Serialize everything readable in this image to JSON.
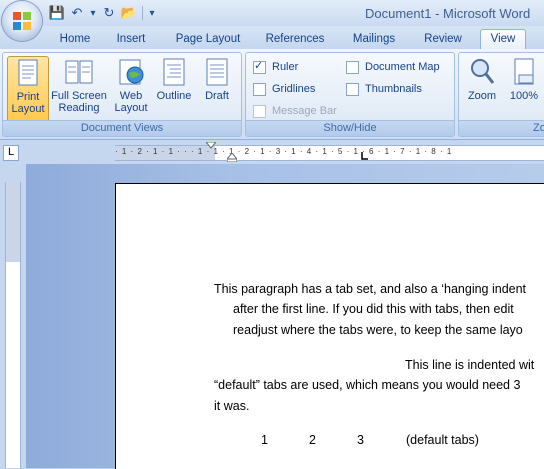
{
  "window": {
    "title": "Document1 - Microsoft Word"
  },
  "quick_access": [
    {
      "name": "save",
      "glyph": "💾"
    },
    {
      "name": "undo",
      "glyph": "↶"
    },
    {
      "name": "undo-dropdown",
      "glyph": "▾"
    },
    {
      "name": "redo",
      "glyph": "↻"
    },
    {
      "name": "open",
      "glyph": "📂"
    },
    {
      "name": "customize",
      "glyph": "▾"
    }
  ],
  "tabs": [
    "Home",
    "Insert",
    "Page Layout",
    "References",
    "Mailings",
    "Review",
    "View"
  ],
  "active_tab": "View",
  "ribbon": {
    "document_views": {
      "label": "Document Views",
      "buttons": [
        "Print\nLayout",
        "Full Screen\nReading",
        "Web\nLayout",
        "Outline",
        "Draft"
      ]
    },
    "show_hide": {
      "label": "Show/Hide",
      "ruler": "Ruler",
      "gridlines": "Gridlines",
      "message_bar": "Message Bar",
      "document_map": "Document Map",
      "thumbnails": "Thumbnails"
    },
    "zoom": {
      "label": "Zo",
      "zoom_label": "Zoom",
      "hundred_label": "100%"
    }
  },
  "ruler": {
    "tab_selector": "L",
    "ticks": "· 1 · 2 · 1 · 1 · ·   · 1 · 1 · 1 · 2 · 1 · 3 · 1 · 4 · 1 · 5 · 1 · 6 · 1 · 7 · 1 · 8 · 1"
  },
  "document": {
    "lines": [
      "This paragraph has a tab set, and also a ‘hanging indent",
      "after the first line. If you did this with tabs, then edit",
      "readjust where the tabs were, to keep the same layo",
      "This line is indented wit",
      "“default” tabs are used, which means you would need 3",
      "it was."
    ],
    "default_tabs": [
      "1",
      "2",
      "3",
      "(default tabs)"
    ]
  },
  "colors": {
    "accent": "#15428b",
    "ribbon": "#dfe9f6",
    "selected": "#ffc94d"
  }
}
